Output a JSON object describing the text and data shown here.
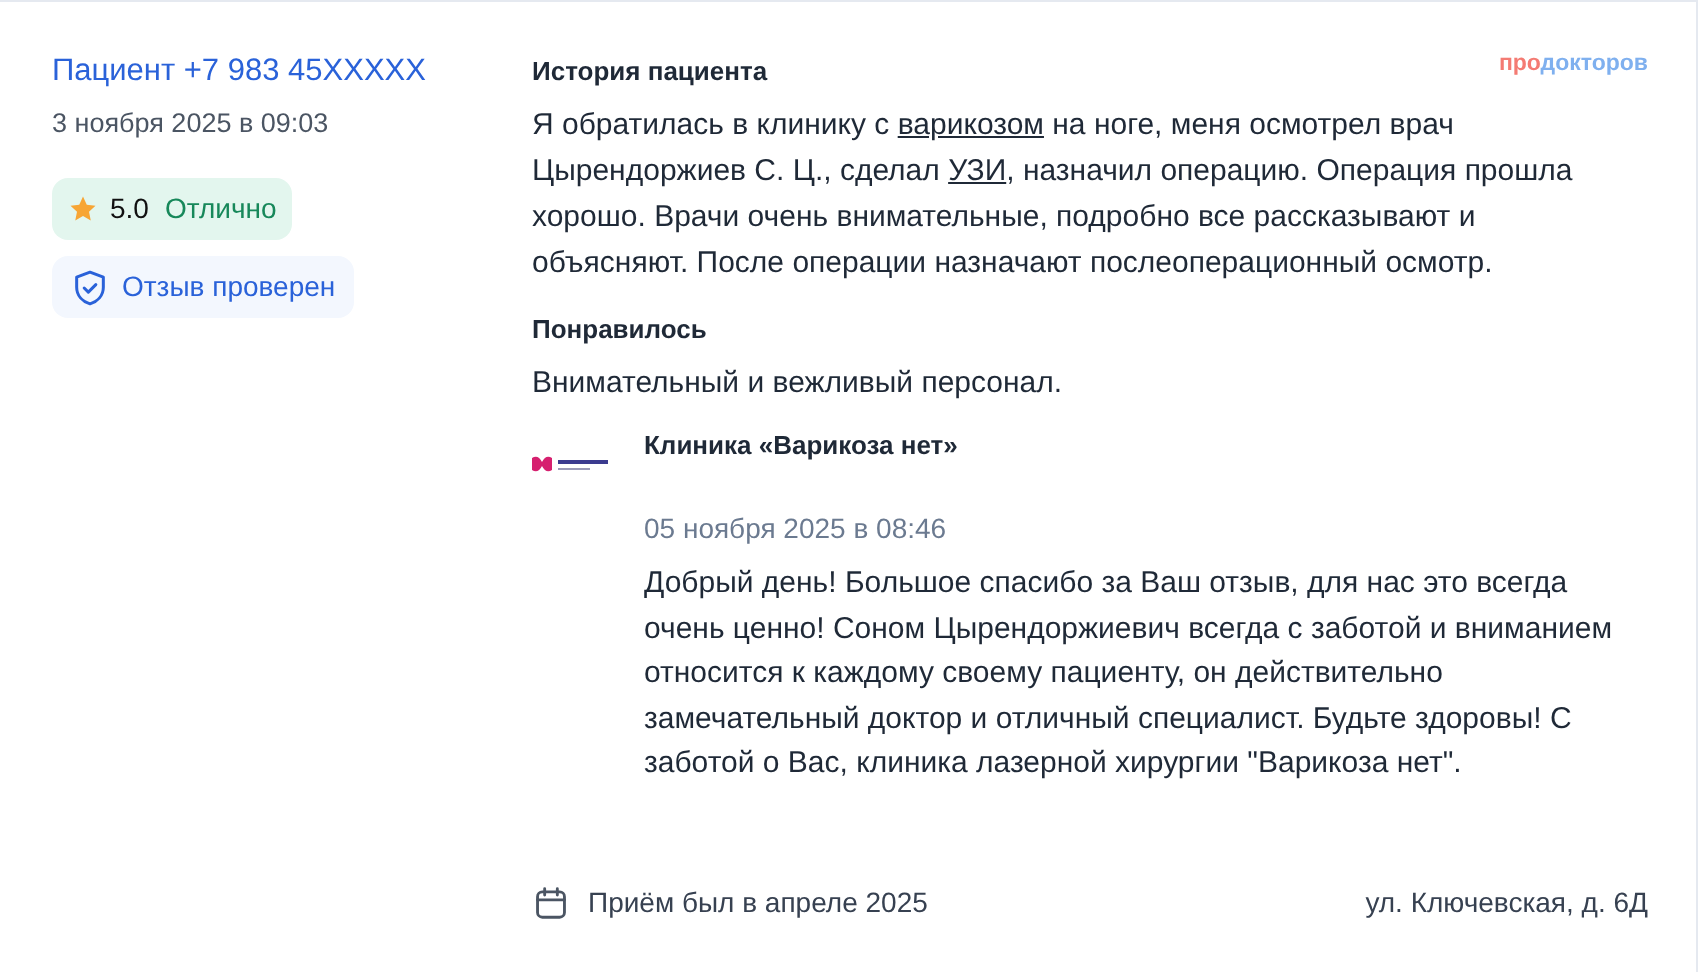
{
  "author": {
    "name": "Пациент +7 983 45XXXXX",
    "date": "3 ноября 2025 в 09:03"
  },
  "rating": {
    "score": "5.0",
    "label": "Отлично"
  },
  "verified": {
    "label": "Отзыв проверен"
  },
  "brand": [
    {
      "text": "про",
      "color": "#f47b73"
    },
    {
      "text": "докторов",
      "color": "#7fb0ef"
    }
  ],
  "history": {
    "title": "История пациента",
    "segments": [
      {
        "kind": "plain",
        "text": "Я обратилась в клинику с "
      },
      {
        "kind": "link",
        "text": "варикозом"
      },
      {
        "kind": "plain",
        "text": " на ноге, меня осмотрел врач Цырендоржиев С. Ц., сделал "
      },
      {
        "kind": "link",
        "text": "УЗИ"
      },
      {
        "kind": "plain",
        "text": ", назначил операцию. Операция прошла хорошо. Врачи очень внимательные, подробно все рассказывают и объясняют. После операции назначают послеоперационный осмотр."
      }
    ]
  },
  "liked": {
    "title": "Понравилось",
    "text": "Внимательный и вежливый персонал."
  },
  "reply": {
    "clinic": "Клиника «Варикоза нет»",
    "date": "05 ноября 2025 в 08:46",
    "text": "Добрый день! Большое спасибо за Ваш отзыв, для нас это всегда очень ценно! Соном Цырендоржиевич всегда с заботой и вниманием относится к каждому своему пациенту, он действительно замечательный доктор и отличный специалист. Будьте здоровы! С заботой о Вас, клиника лазерной хирургии \"Варикоза нет\"."
  },
  "visit": "Приём был в апреле 2025",
  "address": "ул. Ключевская, д. 6Д"
}
